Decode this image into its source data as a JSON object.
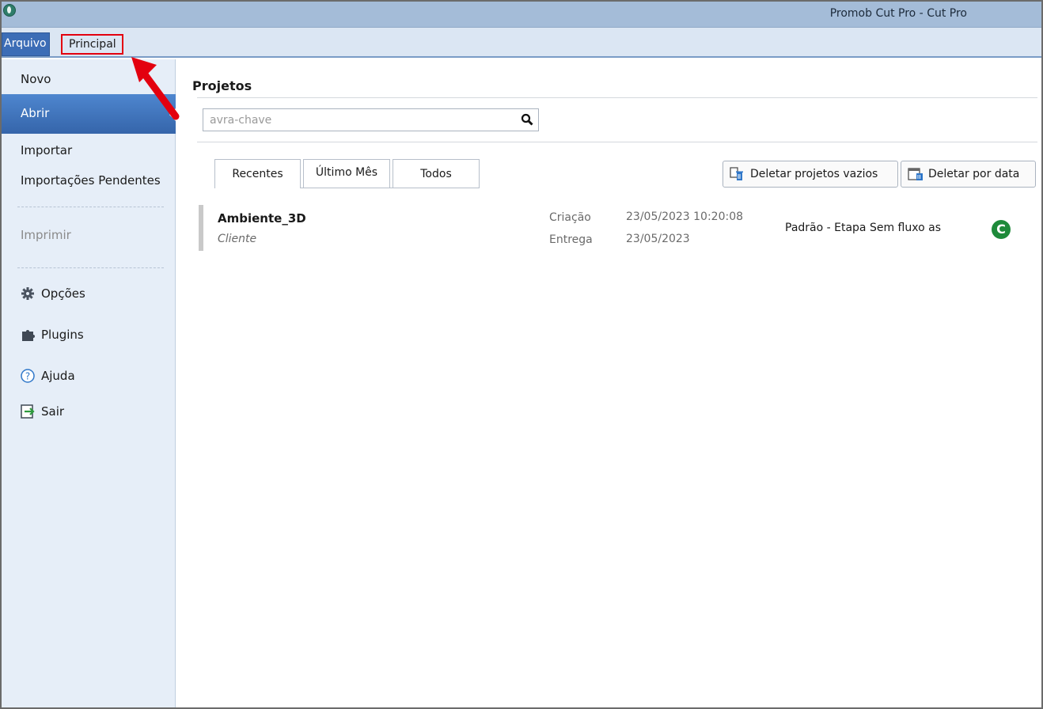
{
  "window": {
    "title": "Promob Cut Pro - Cut Pro"
  },
  "menubar": {
    "arquivo_label": "Arquivo",
    "principal_label": "Principal"
  },
  "sidebar": {
    "items": [
      {
        "label": "Novo"
      },
      {
        "label": "Abrir"
      },
      {
        "label": "Importar"
      },
      {
        "label": "Importações Pendentes"
      },
      {
        "label": "Imprimir"
      },
      {
        "label": "Opções",
        "icon": "gear-icon"
      },
      {
        "label": "Plugins",
        "icon": "puzzle-icon"
      },
      {
        "label": "Ajuda",
        "icon": "help-icon"
      },
      {
        "label": "Sair",
        "icon": "exit-icon"
      }
    ]
  },
  "main": {
    "title": "Projetos",
    "search": {
      "placeholder": "Palavra-chave",
      "visible_text": "avra-chave"
    },
    "tabs": [
      {
        "label": "Recentes",
        "active": true
      },
      {
        "label": "Último Mês"
      },
      {
        "label": "Todos"
      }
    ],
    "buttons": {
      "delete_empty": "Deletar projetos vazios",
      "delete_by_date": "Deletar por data"
    },
    "projects": [
      {
        "name": "Ambiente_3D",
        "client": "Cliente",
        "created_label": "Criação",
        "created_value": "23/05/2023 10:20:08",
        "delivery_label": "Entrega",
        "delivery_value": "23/05/2023",
        "workflow": "Padrão - Etapa Sem fluxo as",
        "status_letter": "C"
      }
    ]
  },
  "colors": {
    "titlebar": "#a4bcd8",
    "menubar": "#dbe6f3",
    "active_menu": "#3c6db6",
    "sidebar": "#e6eef8",
    "active_item": "#3565aa",
    "annotation": "#e3000f",
    "status_badge": "#1e8a3a"
  }
}
